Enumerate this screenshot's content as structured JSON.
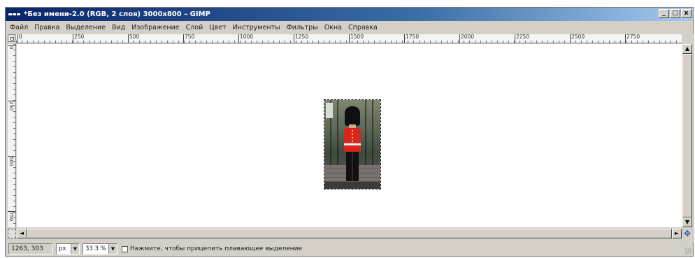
{
  "window": {
    "title": "*Без имени-2.0 (RGB, 2 слоя) 3000x800 – GIMP",
    "controls": {
      "minimize": "_",
      "maximize": "□",
      "close": "x"
    }
  },
  "menu": {
    "items": [
      "Файл",
      "Правка",
      "Выделение",
      "Вид",
      "Изображение",
      "Слой",
      "Цвет",
      "Инструменты",
      "Фильтры",
      "Окна",
      "Справка"
    ]
  },
  "rulers": {
    "horizontal": [
      "0",
      "250",
      "500",
      "750",
      "1000",
      "1250",
      "1500",
      "1750",
      "2000",
      "2250",
      "2500",
      "2750"
    ],
    "vertical": [
      "0",
      "250",
      "500",
      "750"
    ]
  },
  "canvas": {
    "layer_content": "photo of a royal guard in red tunic and bearskin hat in front of a fence"
  },
  "scroll": {
    "up": "▲",
    "down": "▼",
    "left": "◄",
    "right": "►",
    "navigate": "✥"
  },
  "statusbar": {
    "coords": "1263, 303",
    "unit": "px",
    "zoom": "33.3 %",
    "message": "Нажмите, чтобы прицепить плавающее выделение"
  },
  "colors": {
    "titlebar_start": "#0a246a",
    "titlebar_end": "#a6caf0",
    "chrome": "#d4d0c8",
    "canvas": "#ffffff",
    "tunic_red": "#d8261e"
  }
}
